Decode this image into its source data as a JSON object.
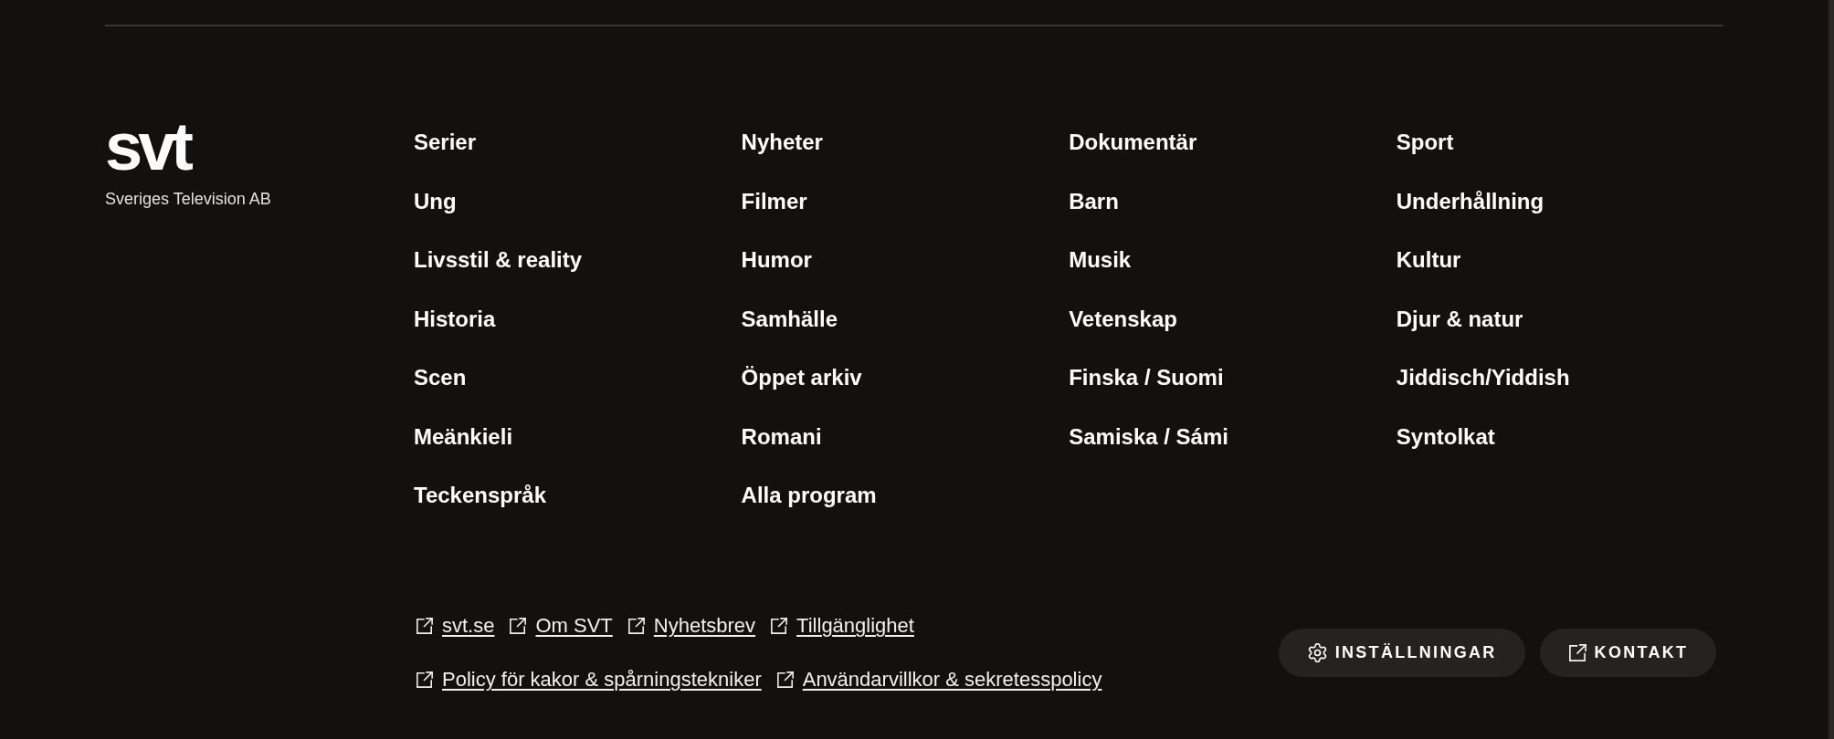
{
  "logo": {
    "wordmark": "svt",
    "tagline": "Sveriges Television AB"
  },
  "nav_links": [
    "Serier",
    "Nyheter",
    "Dokumentär",
    "Sport",
    "Ung",
    "Filmer",
    "Barn",
    "Underhållning",
    "Livsstil & reality",
    "Humor",
    "Musik",
    "Kultur",
    "Historia",
    "Samhälle",
    "Vetenskap",
    "Djur & natur",
    "Scen",
    "Öppet arkiv",
    "Finska / Suomi",
    "Jiddisch/Yiddish",
    "Meänkieli",
    "Romani",
    "Samiska / Sámi",
    "Syntolkat",
    "Teckenspråk",
    "Alla program"
  ],
  "info_links": [
    {
      "links": [
        "svt.se",
        "Om SVT",
        "Nyhetsbrev",
        "Tillgänglighet"
      ]
    },
    {
      "links": [
        "Policy för kakor & spårningstekniker",
        "Användarvillkor & sekretesspolicy"
      ]
    }
  ],
  "buttons": [
    {
      "label": "INSTÄLLNINGAR",
      "kind": "settings"
    },
    {
      "label": "KONTAKT",
      "kind": "external"
    }
  ]
}
